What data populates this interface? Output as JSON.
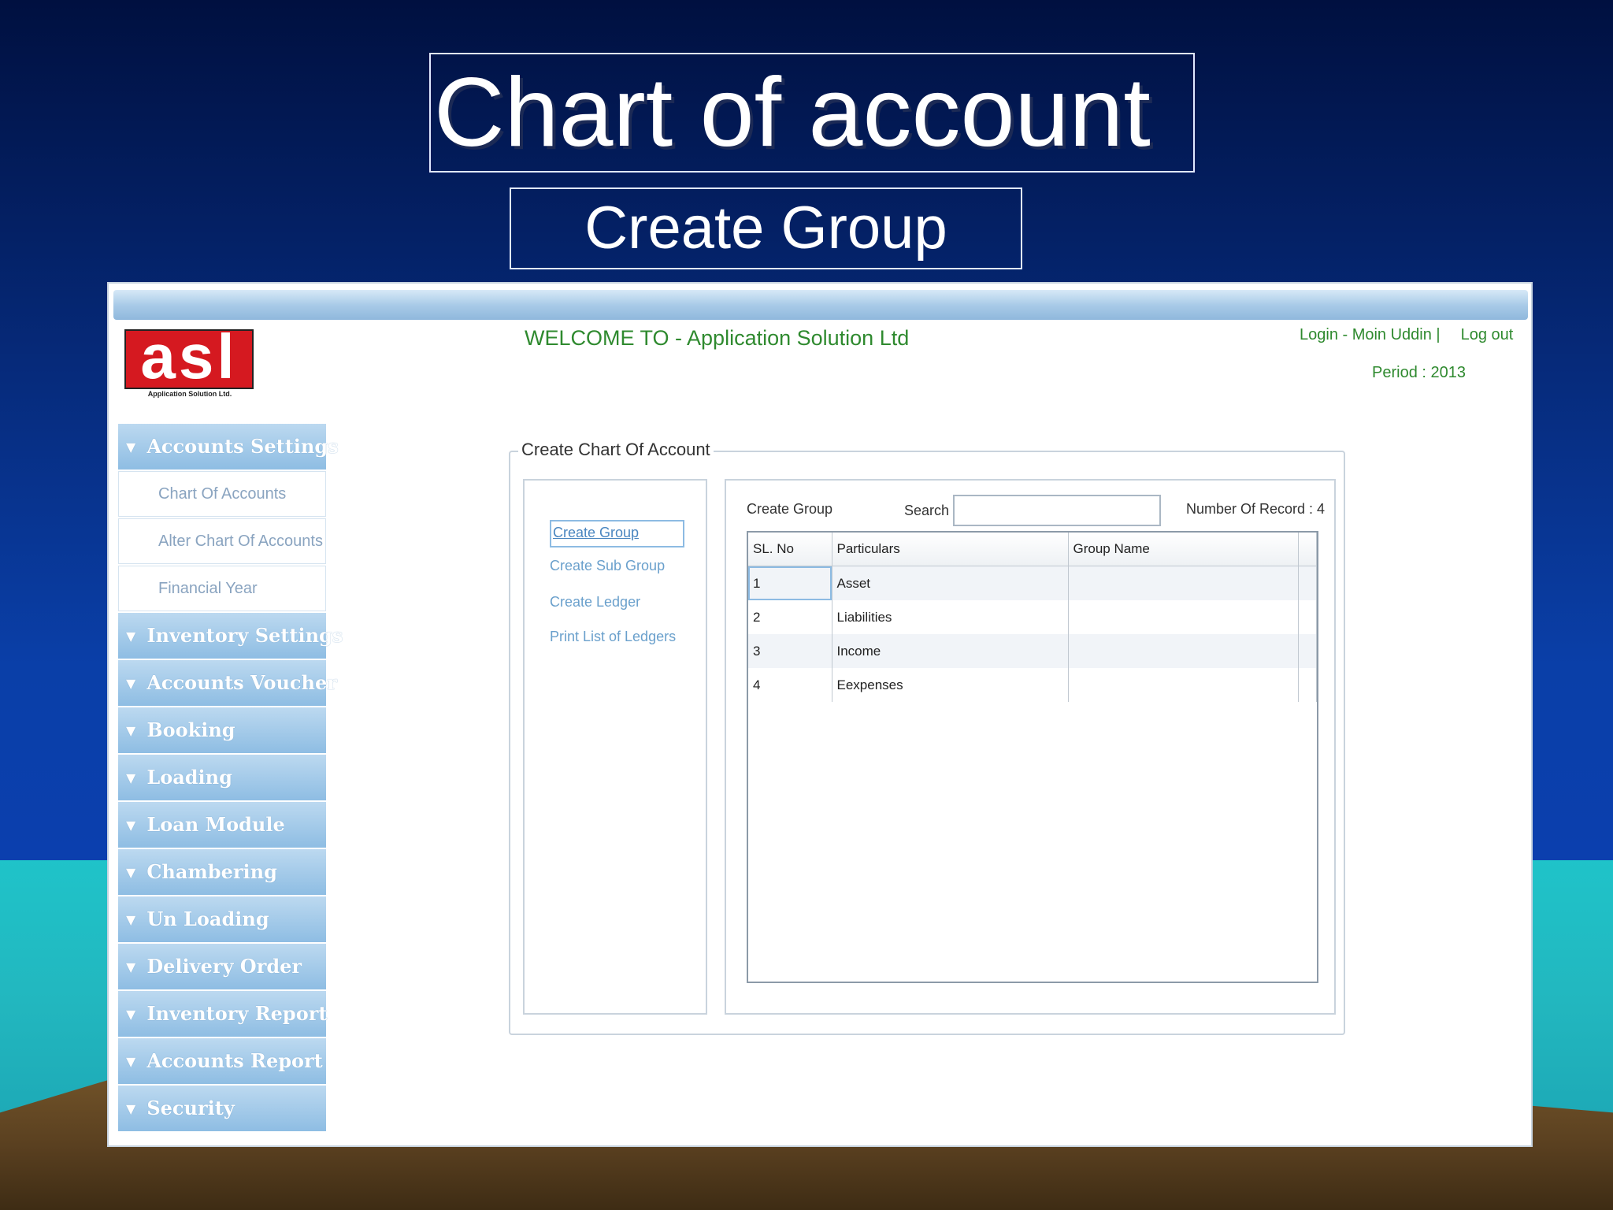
{
  "slide": {
    "title": "Chart of account",
    "subtitle": "Create Group"
  },
  "header": {
    "logo_text": "asl",
    "logo_tagline": "Application Solution Ltd.",
    "welcome": "WELCOME TO - Application Solution Ltd",
    "login": "Login - Moin Uddin |",
    "logout": "Log out",
    "period": "Period : 2013"
  },
  "sidebar": {
    "accounts_settings": "Accounts Settings",
    "sub_items": [
      "Chart Of Accounts",
      "Alter Chart Of Accounts",
      "Financial Year"
    ],
    "sections": [
      "Inventory Settings",
      "Accounts Voucher",
      "Booking",
      "Loading",
      "Loan Module",
      "Chambering",
      "Un Loading",
      "Delivery Order",
      "Inventory Report",
      "Accounts Report",
      "Security"
    ]
  },
  "main": {
    "legend": "Create Chart Of Account",
    "links": [
      "Create Group",
      "Create Sub Group",
      "Create Ledger",
      "Print List of Ledgers"
    ],
    "panel_title": "Create Group",
    "search_label": "Search",
    "search_value": "",
    "record_count": "Number Of Record : 4",
    "columns": [
      "SL. No",
      "Particulars",
      "Group Name"
    ],
    "rows": [
      {
        "sl": "1",
        "particulars": "Asset",
        "group": ""
      },
      {
        "sl": "2",
        "particulars": "Liabilities",
        "group": ""
      },
      {
        "sl": "3",
        "particulars": "Income",
        "group": ""
      },
      {
        "sl": "4",
        "particulars": "Eexpenses",
        "group": ""
      }
    ]
  },
  "colors": {
    "accent_green": "#2f8a2f",
    "logo_red": "#d51920",
    "sidebar_blue": "#8ebde3"
  }
}
